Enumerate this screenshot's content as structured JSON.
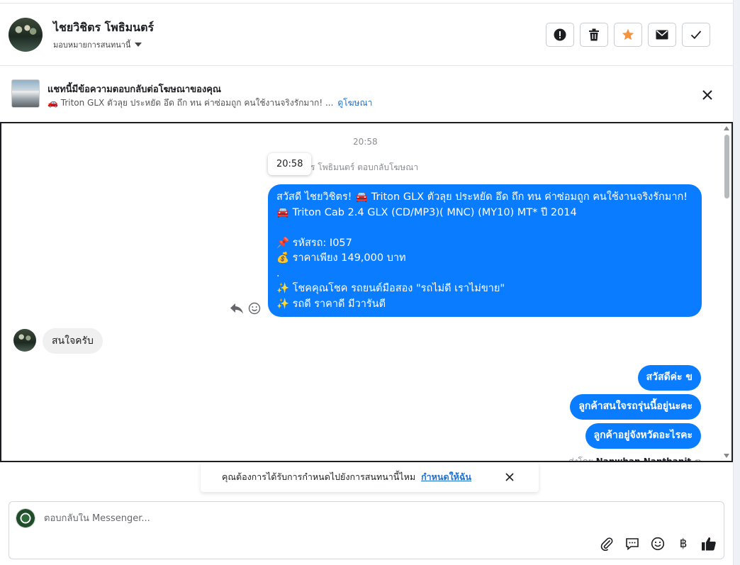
{
  "header": {
    "user_name": "ไชยวิชิตร โพธิมนตร์",
    "assign_label": "มอบหมายการสนทนานี้"
  },
  "ad_banner": {
    "title": "แชทนี้มีข้อความตอบกลับต่อโฆษณาของคุณ",
    "subtitle": "🚗 Triton GLX ตัวลุย ประหยัด อึด ถึก ทน ค่าซ่อมถูก คนใช้งานจริงรักมาก! ...",
    "link": "ดูโฆษณา"
  },
  "chat": {
    "timestamp_top": "20:58",
    "tooltip_time": "20:58",
    "reply_note": "ร โพธิมนตร์ ตอบกลับโฆษณา",
    "big_message": "สวัสดี ไชยวิชิตร! 🚘 Triton GLX ตัวลุย ประหยัด อึด ถึก ทน ค่าซ่อมถูก คนใช้งานจริงรักมาก!\n🚘 Triton Cab 2.4 GLX (CD/MP3)( MNC) (MY10) MT* ปี 2014\n\n📌 รหัสรถ: I057\n💰 ราคาเพียง 149,000 บาท\n.\n✨ โชคคุณโชค รถยนต์มือสอง \"รถไม่ดี เราไม่ขาย\"\n✨ รถดี ราคาดี มีวารันตี",
    "incoming_message": "สนใจครับ",
    "outgoing_short": [
      "สวัสดีค่ะ  ข",
      "ลูกค้าสนใจรถรุ่นนี้อยู่นะคะ",
      "ลูกค้าอยู่จังหวัดอะไรคะ"
    ],
    "sent_by_label": "ส่งโดย",
    "sent_by_name": "Nanwhan Nanthanit"
  },
  "reminder": {
    "text": "คุณต้องการได้รับการกำหนดไปยังการสนทนานี้ไหม",
    "link": "กำหนดให้ฉัน"
  },
  "composer": {
    "placeholder": "ตอบกลับใน Messenger..."
  },
  "colors": {
    "bubble_out": "#0a7cff",
    "bubble_in": "#f0f0f0",
    "link": "#1f6fd0",
    "star": "#f5923e"
  },
  "icons": {
    "header_actions": [
      "spam-icon",
      "trash-icon",
      "star-icon",
      "mail-icon",
      "check-icon"
    ],
    "composer_tools": [
      "paperclip-icon",
      "saved-reply-icon",
      "emoji-icon",
      "baht-icon",
      "like-icon"
    ]
  }
}
